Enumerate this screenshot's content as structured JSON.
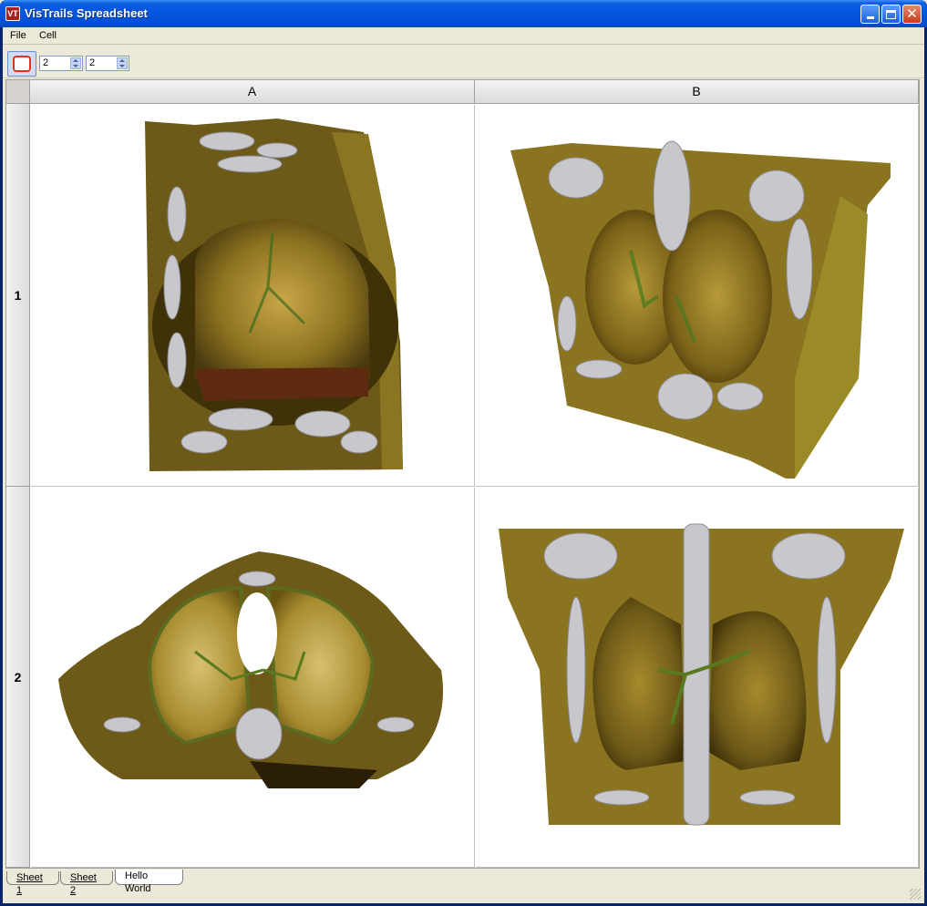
{
  "window": {
    "title": "VisTrails Spreadsheet",
    "icon": "vistrails-app-icon",
    "icon_text": "VT",
    "controls": [
      "minimize-icon",
      "maximize-icon",
      "close-icon"
    ]
  },
  "menubar": {
    "items": [
      "File",
      "Cell"
    ]
  },
  "toolbar": {
    "fit_button_icon": "fit-to-window-icon",
    "row_count": "2",
    "column_count": "2"
  },
  "spreadsheet": {
    "columns": [
      "A",
      "B"
    ],
    "rows": [
      "1",
      "2"
    ],
    "cells": [
      {
        "id": "A1",
        "content": "coronal-oblique-chest-volume-render"
      },
      {
        "id": "B1",
        "content": "frontal-oblique-chest-volume-render"
      },
      {
        "id": "A2",
        "content": "axial-chest-volume-render"
      },
      {
        "id": "B2",
        "content": "frontal-chest-volume-render"
      }
    ]
  },
  "sheet_tabs": {
    "items": [
      "Sheet 1",
      "Sheet 2",
      "Hello World"
    ],
    "active": "Hello World"
  },
  "colors": {
    "title_bar": "#0455df",
    "tissue_gold": "#b89a2e",
    "tissue_dark": "#4a3a10",
    "bone": "#c8c8cc"
  }
}
